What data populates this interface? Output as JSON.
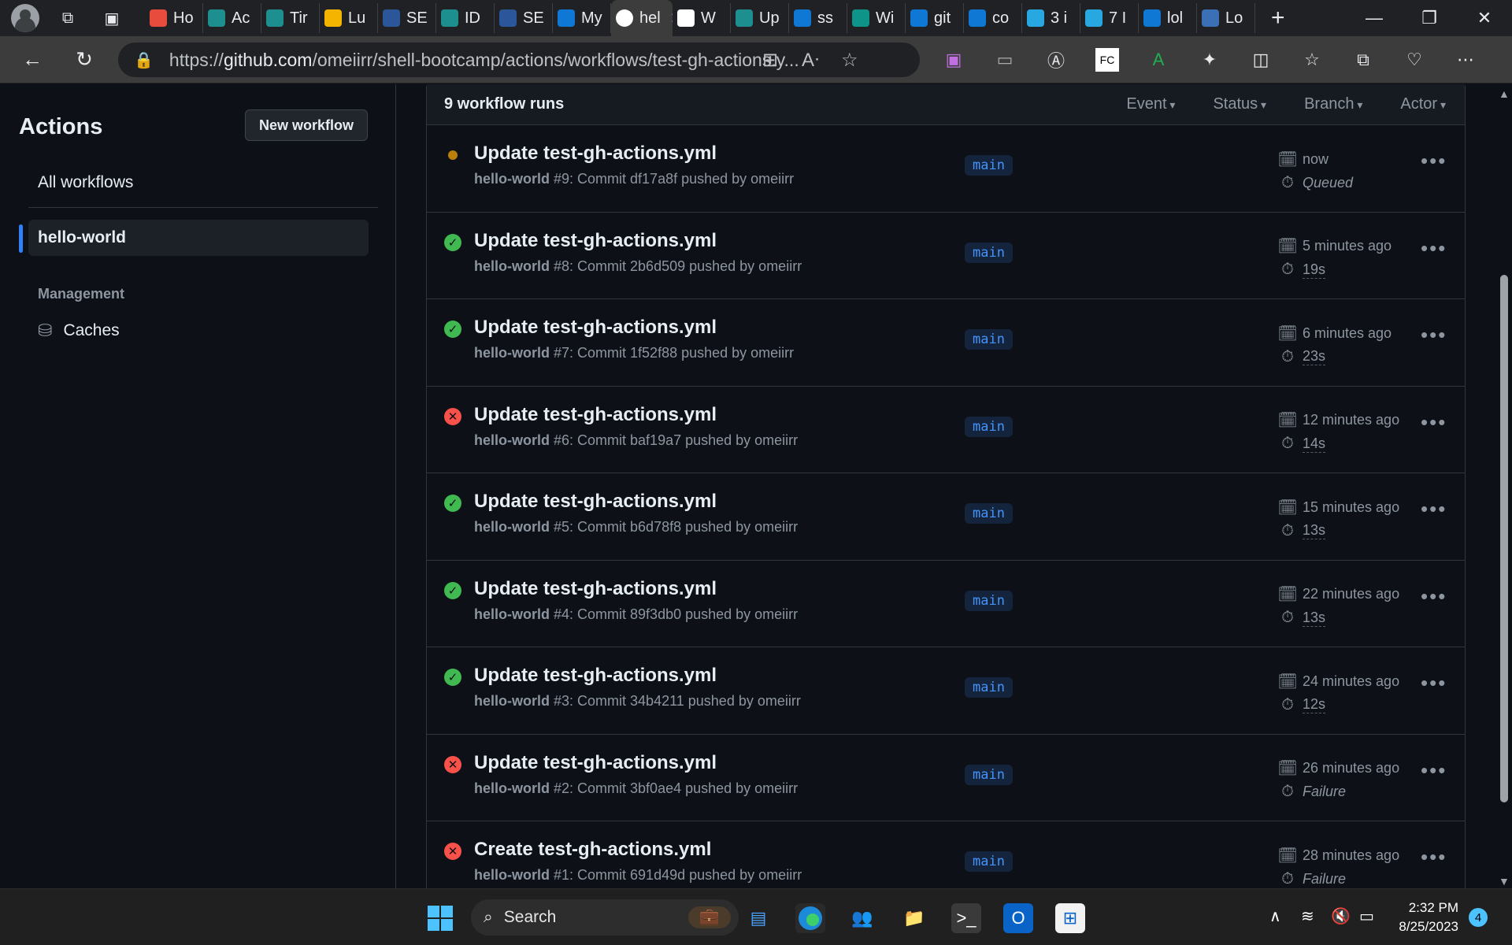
{
  "browser": {
    "tabs": [
      {
        "label": "Ho",
        "color": "#e84c3d"
      },
      {
        "label": "Ac",
        "color": "#1d8f8f"
      },
      {
        "label": "Tir",
        "color": "#1d8f8f"
      },
      {
        "label": "Lu",
        "color": "#f4b400"
      },
      {
        "label": "SE",
        "color": "#2b579a"
      },
      {
        "label": "ID",
        "color": "#1d8f8f"
      },
      {
        "label": "SE",
        "color": "#2b579a"
      },
      {
        "label": "My",
        "color": "#0f78d4"
      },
      {
        "label": "hel",
        "color": "",
        "active": true
      },
      {
        "label": "W",
        "color": "#ffffff"
      },
      {
        "label": "Up",
        "color": "#1d8f8f"
      },
      {
        "label": "ss",
        "color": "#0f78d4"
      },
      {
        "label": "Wi",
        "color": "#0e9488"
      },
      {
        "label": "git",
        "color": "#0f78d4"
      },
      {
        "label": "co",
        "color": "#0f78d4"
      },
      {
        "label": "3 i",
        "color": "#28a8e0"
      },
      {
        "label": "7 I",
        "color": "#28a8e0"
      },
      {
        "label": "lol",
        "color": "#0f78d4"
      },
      {
        "label": "Lo",
        "color": "#3b6fb6"
      }
    ],
    "url_prefix": "https://",
    "url_host": "github.com",
    "url_path": "/omeiirr/shell-bootcamp/actions/workflows/test-gh-actions.y..."
  },
  "sidebar": {
    "title": "Actions",
    "new_workflow": "New workflow",
    "all_workflows": "All workflows",
    "selected_workflow": "hello-world",
    "management_heading": "Management",
    "caches": "Caches"
  },
  "runs": {
    "count_label": "9 workflow runs",
    "filters": [
      "Event",
      "Status",
      "Branch",
      "Actor"
    ],
    "items": [
      {
        "status": "queued",
        "title": "Update test-gh-actions.yml",
        "workflow": "hello-world",
        "detail": "#9: Commit df17a8f pushed by omeiirr",
        "branch": "main",
        "time": "now",
        "duration": "Queued",
        "duration_italic": true
      },
      {
        "status": "success",
        "title": "Update test-gh-actions.yml",
        "workflow": "hello-world",
        "detail": "#8: Commit 2b6d509 pushed by omeiirr",
        "branch": "main",
        "time": "5 minutes ago",
        "duration": "19s",
        "duration_italic": false
      },
      {
        "status": "success",
        "title": "Update test-gh-actions.yml",
        "workflow": "hello-world",
        "detail": "#7: Commit 1f52f88 pushed by omeiirr",
        "branch": "main",
        "time": "6 minutes ago",
        "duration": "23s",
        "duration_italic": false
      },
      {
        "status": "failure",
        "title": "Update test-gh-actions.yml",
        "workflow": "hello-world",
        "detail": "#6: Commit baf19a7 pushed by omeiirr",
        "branch": "main",
        "time": "12 minutes ago",
        "duration": "14s",
        "duration_italic": false
      },
      {
        "status": "success",
        "title": "Update test-gh-actions.yml",
        "workflow": "hello-world",
        "detail": "#5: Commit b6d78f8 pushed by omeiirr",
        "branch": "main",
        "time": "15 minutes ago",
        "duration": "13s",
        "duration_italic": false
      },
      {
        "status": "success",
        "title": "Update test-gh-actions.yml",
        "workflow": "hello-world",
        "detail": "#4: Commit 89f3db0 pushed by omeiirr",
        "branch": "main",
        "time": "22 minutes ago",
        "duration": "13s",
        "duration_italic": false
      },
      {
        "status": "success",
        "title": "Update test-gh-actions.yml",
        "workflow": "hello-world",
        "detail": "#3: Commit 34b4211 pushed by omeiirr",
        "branch": "main",
        "time": "24 minutes ago",
        "duration": "12s",
        "duration_italic": false
      },
      {
        "status": "failure",
        "title": "Update test-gh-actions.yml",
        "workflow": "hello-world",
        "detail": "#2: Commit 3bf0ae4 pushed by omeiirr",
        "branch": "main",
        "time": "26 minutes ago",
        "duration": "Failure",
        "duration_italic": true
      },
      {
        "status": "failure",
        "title": "Create test-gh-actions.yml",
        "workflow": "hello-world",
        "detail": "#1: Commit 691d49d pushed by omeiirr",
        "branch": "main",
        "time": "28 minutes ago",
        "duration": "Failure",
        "duration_italic": true
      }
    ]
  },
  "taskbar": {
    "search_label": "Search",
    "time": "2:32 PM",
    "date": "8/25/2023",
    "notification_count": "4"
  }
}
